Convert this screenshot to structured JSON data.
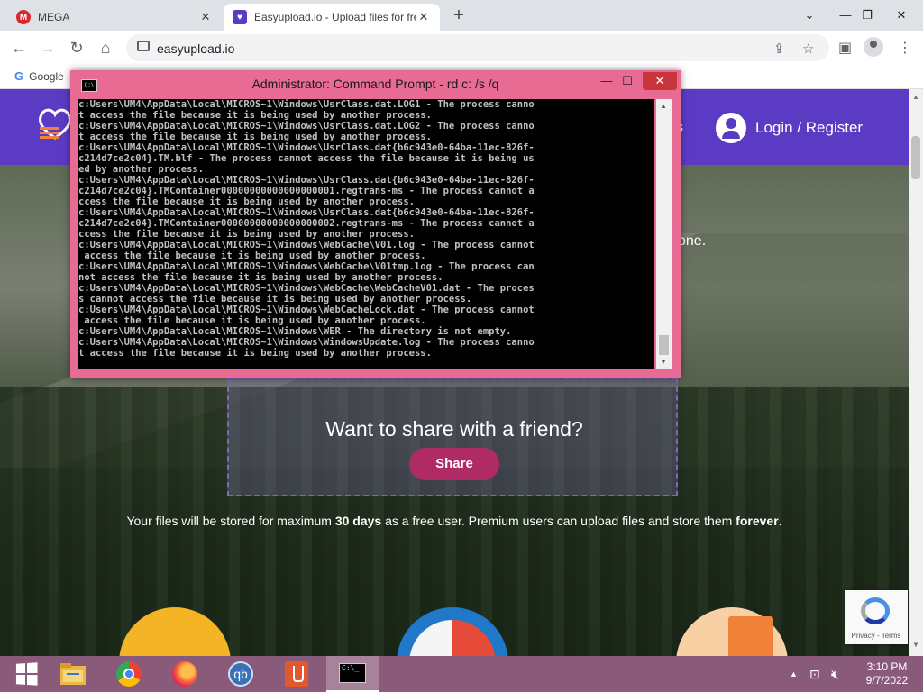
{
  "browser": {
    "tabs": [
      {
        "title": "MEGA",
        "favicon": "mega-icon",
        "active": false
      },
      {
        "title": "Easyupload.io - Upload files for free",
        "favicon": "easyupload-icon",
        "active": true
      }
    ],
    "new_tab": "+",
    "url": "easyupload.io",
    "bookmarks": [
      {
        "label": "Google"
      }
    ]
  },
  "website": {
    "nav_partial": "s",
    "login_label": "Login / Register",
    "hero_partial": "one.",
    "share_question": "Want to share with a friend?",
    "share_button": "Share",
    "storage_note": {
      "part1": "Your files will be stored for maximum ",
      "bold1": "30 days",
      "part2": " as a free user. Premium users can upload files and store them ",
      "bold2": "forever",
      "part3": "."
    },
    "recaptcha_terms": "Privacy - Terms"
  },
  "cmd": {
    "title": "Administrator: Command Prompt - rd  c: /s /q",
    "lines": [
      "c:Users\\UM4\\AppData\\Local\\MICROS~1\\Windows\\UsrClass.dat.LOG1 - The process canno",
      "t access the file because it is being used by another process.",
      "c:Users\\UM4\\AppData\\Local\\MICROS~1\\Windows\\UsrClass.dat.LOG2 - The process canno",
      "t access the file because it is being used by another process.",
      "c:Users\\UM4\\AppData\\Local\\MICROS~1\\Windows\\UsrClass.dat{b6c943e0-64ba-11ec-826f-",
      "c214d7ce2c04}.TM.blf - The process cannot access the file because it is being us",
      "ed by another process.",
      "c:Users\\UM4\\AppData\\Local\\MICROS~1\\Windows\\UsrClass.dat{b6c943e0-64ba-11ec-826f-",
      "c214d7ce2c04}.TMContainer00000000000000000001.regtrans-ms - The process cannot a",
      "ccess the file because it is being used by another process.",
      "c:Users\\UM4\\AppData\\Local\\MICROS~1\\Windows\\UsrClass.dat{b6c943e0-64ba-11ec-826f-",
      "c214d7ce2c04}.TMContainer00000000000000000002.regtrans-ms - The process cannot a",
      "ccess the file because it is being used by another process.",
      "c:Users\\UM4\\AppData\\Local\\MICROS~1\\Windows\\WebCache\\V01.log - The process cannot",
      " access the file because it is being used by another process.",
      "c:Users\\UM4\\AppData\\Local\\MICROS~1\\Windows\\WebCache\\V01tmp.log - The process can",
      "not access the file because it is being used by another process.",
      "c:Users\\UM4\\AppData\\Local\\MICROS~1\\Windows\\WebCache\\WebCacheV01.dat - The proces",
      "s cannot access the file because it is being used by another process.",
      "c:Users\\UM4\\AppData\\Local\\MICROS~1\\Windows\\WebCacheLock.dat - The process cannot",
      " access the file because it is being used by another process.",
      "c:Users\\UM4\\AppData\\Local\\MICROS~1\\Windows\\WER - The directory is not empty.",
      "c:Users\\UM4\\AppData\\Local\\MICROS~1\\Windows\\WindowsUpdate.log - The process canno",
      "t access the file because it is being used by another process."
    ]
  },
  "taskbar": {
    "items": [
      {
        "name": "start-button",
        "icon": "windows-logo-icon"
      },
      {
        "name": "file-explorer",
        "icon": "folder-icon"
      },
      {
        "name": "chrome",
        "icon": "chrome-icon"
      },
      {
        "name": "firefox",
        "icon": "firefox-icon"
      },
      {
        "name": "qbittorrent",
        "icon": "qbittorrent-icon",
        "label": "qb"
      },
      {
        "name": "app-orange",
        "icon": "orange-app-icon"
      },
      {
        "name": "command-prompt",
        "icon": "cmd-icon",
        "active": true
      }
    ],
    "time": "3:10 PM",
    "date": "9/7/2022"
  },
  "colors": {
    "site_header": "#5b3bc4",
    "share_button": "#b02a66",
    "cmd_frame": "#e76b93",
    "taskbar": "#8a5a7a"
  }
}
